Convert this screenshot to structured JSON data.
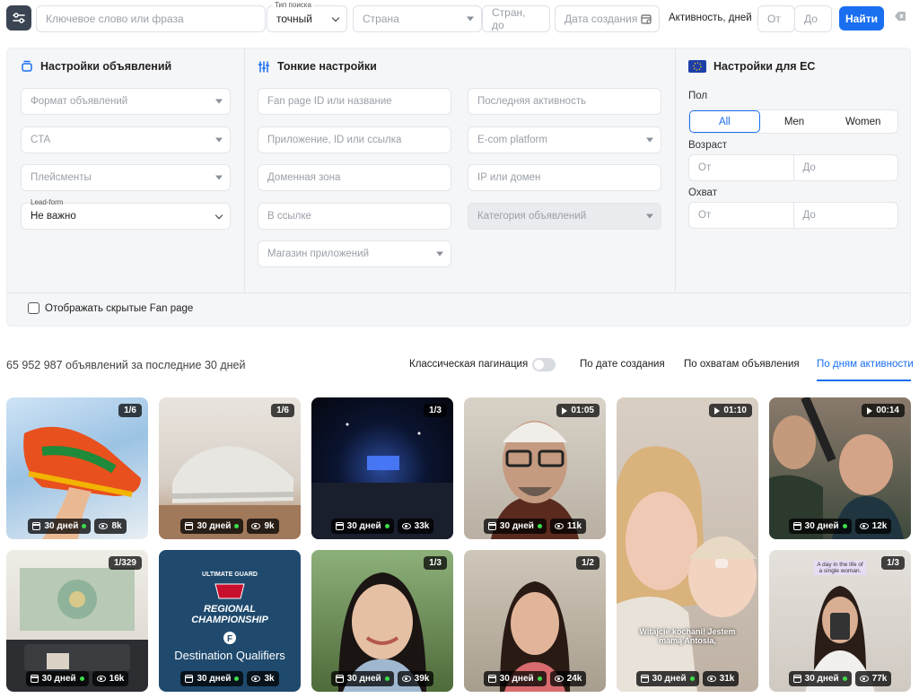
{
  "search": {
    "keyword_placeholder": "Ключевое слово или фраза",
    "type_label": "Тип поиска",
    "type_value": "точный",
    "country_placeholder": "Страна",
    "countries_upto_placeholder": "Стран, до",
    "created_date_placeholder": "Дата создания",
    "activity_label": "Активность, дней",
    "from_placeholder": "От",
    "to_placeholder": "До",
    "find_label": "Найти"
  },
  "ad_settings": {
    "title": "Настройки объявлений",
    "format_placeholder": "Формат объявлений",
    "cta_placeholder": "CTA",
    "placements_placeholder": "Плейсменты",
    "leadform_label": "Lead-form",
    "leadform_value": "Не важно"
  },
  "fine_settings": {
    "title": "Тонкие настройки",
    "fanpage_placeholder": "Fan page ID или название",
    "app_placeholder": "Приложение, ID или ссылка",
    "domain_zone_placeholder": "Доменная зона",
    "in_link_placeholder": "В ссылке",
    "app_store_placeholder": "Магазин приложений",
    "last_activity_placeholder": "Последняя активность",
    "ecom_placeholder": "E-com platform",
    "ip_placeholder": "IP или домен",
    "ad_category_placeholder": "Категория объявлений"
  },
  "eu_settings": {
    "title": "Настройки для ЕС",
    "gender_label": "Пол",
    "gender_options": [
      "All",
      "Men",
      "Women"
    ],
    "age_label": "Возраст",
    "reach_label": "Охват",
    "from_placeholder": "От",
    "to_placeholder": "До"
  },
  "hidden_fanpage_label": "Отображать скрытые Fan page",
  "results": {
    "summary": "65 952 987 объявлений за последние 30 дней",
    "classic_pagination_label": "Классическая пагинация",
    "sort_by_date": "По дате создания",
    "sort_by_reach": "По охватам объявления",
    "sort_by_activity": "По дням активности"
  },
  "cards": [
    {
      "badge": "1/6",
      "days": "30 дней",
      "views": "8k",
      "video": false
    },
    {
      "badge": "1/6",
      "days": "30 дней",
      "views": "9k",
      "video": false
    },
    {
      "badge": "1/3",
      "days": "30 дней",
      "views": "33k",
      "video": false
    },
    {
      "badge": "01:05",
      "days": "30 дней",
      "views": "11k",
      "video": true
    },
    {
      "badge": "01:10",
      "days": "30 дней",
      "views": "31k",
      "video": true,
      "caption": "Witajcie kochani! Jestem mamą Antosia,"
    },
    {
      "badge": "00:14",
      "days": "30 дней",
      "views": "12k",
      "video": true
    },
    {
      "badge": "1/329",
      "days": "30 дней",
      "views": "16k",
      "video": false
    },
    {
      "badge": "",
      "days": "30 дней",
      "views": "3k",
      "video": false,
      "logo_text": "ULTIMATE GUARD",
      "banner_text": "REGIONAL CHAMPIONSHIP",
      "subtitle": "Destination Qualifiers"
    },
    {
      "badge": "1/3",
      "days": "30 дней",
      "views": "39k",
      "video": false
    },
    {
      "badge": "1/2",
      "days": "30 дней",
      "views": "24k",
      "video": false
    },
    {
      "badge": "1/3",
      "days": "30 дней",
      "views": "77k",
      "video": false,
      "caption": "A day in the life of a single woman."
    }
  ],
  "colors": {
    "accent": "#1a6ff0",
    "dark_button": "#3b4453",
    "activity_dot": "#3ddc4a"
  }
}
